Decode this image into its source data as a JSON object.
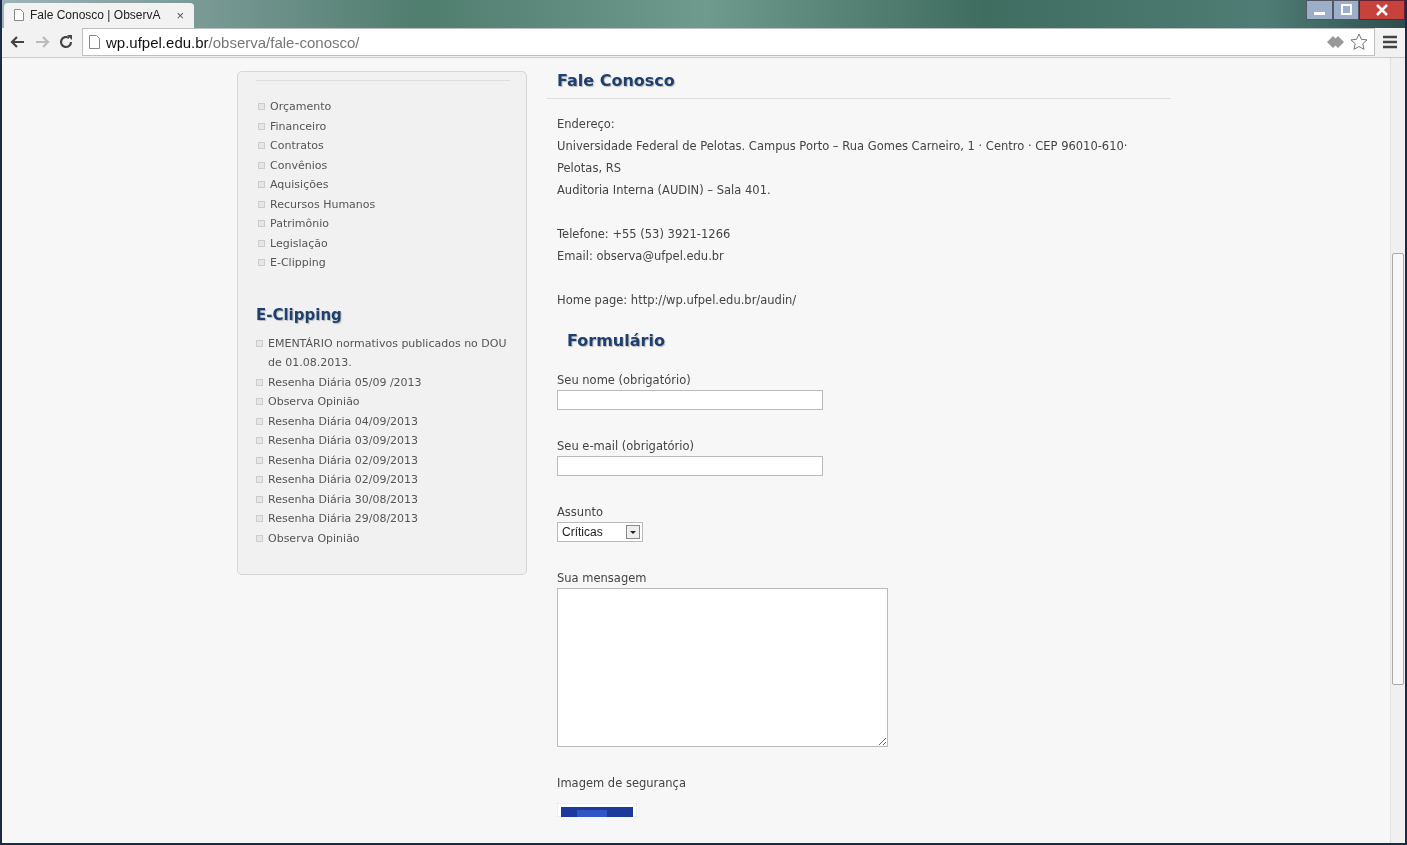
{
  "browser": {
    "tab": {
      "title": "Fale Conosco | ObservA",
      "close": "×",
      "selected": true
    },
    "address": {
      "host": "wp.ufpel.edu.br",
      "path": "/observa/fale-conosco/"
    }
  },
  "sidebar": {
    "menu": [
      {
        "label": "Orçamento"
      },
      {
        "label": "Financeiro"
      },
      {
        "label": "Contratos"
      },
      {
        "label": "Convênios"
      },
      {
        "label": "Aquisições"
      },
      {
        "label": "Recursos Humanos"
      },
      {
        "label": "Patrimônio"
      },
      {
        "label": "Legislação"
      },
      {
        "label": "E-Clipping"
      }
    ],
    "clipping": {
      "title": "E-Clipping",
      "items": [
        {
          "label": "EMENTÁRIO normativos publicados no DOU de 01.08.2013."
        },
        {
          "label": "Resenha Diária 05/09 /2013"
        },
        {
          "label": "Observa Opinião"
        },
        {
          "label": "Resenha Diária 04/09/2013"
        },
        {
          "label": "Resenha Diária 03/09/2013"
        },
        {
          "label": "Resenha Diária 02/09/2013"
        },
        {
          "label": "Resenha Diária 02/09/2013"
        },
        {
          "label": "Resenha Diária 30/08/2013"
        },
        {
          "label": "Resenha Diária 29/08/2013"
        },
        {
          "label": "Observa Opinião"
        }
      ]
    }
  },
  "content": {
    "title": "Fale Conosco",
    "paragraphs": [
      [
        "Endereço:",
        "Universidade Federal de Pelotas. Campus Porto – Rua Gomes Carneiro, 1 · Centro · CEP 96010-610·",
        "Pelotas, RS",
        "Auditoria Interna (AUDIN) – Sala 401."
      ],
      [
        "Telefone: +55 (53) 3921-1266",
        "Email: observa@ufpel.edu.br"
      ],
      [
        "Home page: http://wp.ufpel.edu.br/audin/"
      ]
    ],
    "form_title": "Formulário",
    "fields": [
      {
        "kind": "text",
        "label": "Seu nome (obrigatório)"
      },
      {
        "kind": "text",
        "label": "Seu e-mail (obrigatório)"
      },
      {
        "kind": "select",
        "label": "Assunto",
        "value": "Críticas"
      },
      {
        "kind": "textarea",
        "label": "Sua mensagem"
      },
      {
        "kind": "captcha",
        "label": "Imagem de segurança"
      }
    ]
  }
}
